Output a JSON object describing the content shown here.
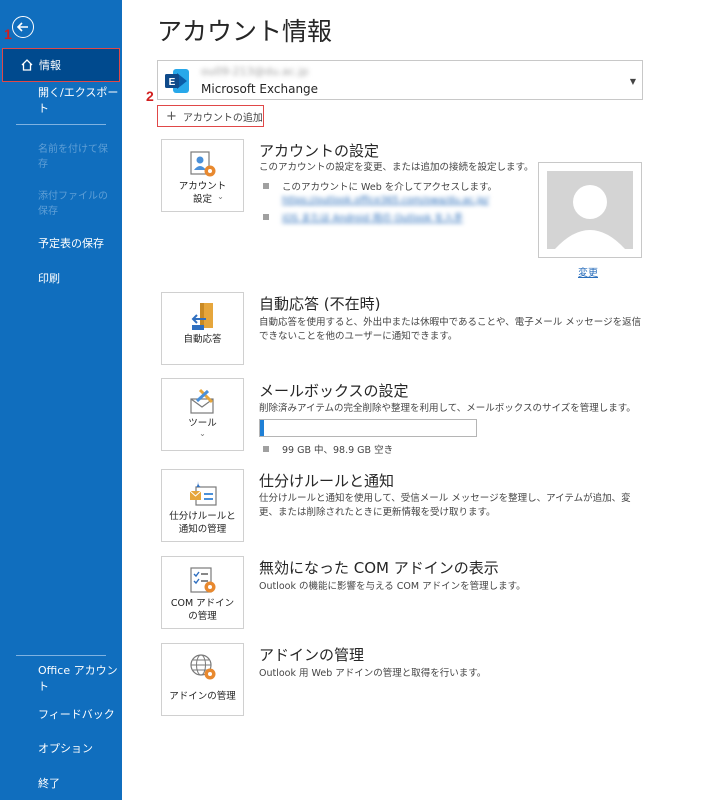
{
  "steps": {
    "step1": "1",
    "step2": "2"
  },
  "sidebar": {
    "items": [
      {
        "label": "情報",
        "state": "active"
      },
      {
        "label": "開く/エクスポート",
        "state": "normal"
      },
      {
        "label": "名前を付けて保存",
        "state": "disabled"
      },
      {
        "label": "添付ファイルの保存",
        "state": "disabled"
      },
      {
        "label": "予定表の保存",
        "state": "normal"
      },
      {
        "label": "印刷",
        "state": "normal"
      }
    ],
    "bottom_items": [
      {
        "label": "Office アカウント"
      },
      {
        "label": "フィードバック"
      },
      {
        "label": "オプション"
      },
      {
        "label": "終了"
      }
    ]
  },
  "main": {
    "title": "アカウント情報",
    "account": {
      "email": "ou09-213@du.ac.jp",
      "type": "Microsoft Exchange"
    },
    "add_account_label": "アカウントの追加",
    "sections": [
      {
        "tile_label": "アカウント\n設定",
        "tile_has_dropdown": true,
        "title": "アカウントの設定",
        "description": "このアカウントの設定を変更、または追加の接続を設定します。",
        "bullet1": "このアカウントに Web を介してアクセスします。",
        "link1": "https://outlook.office365.com/owa/du.ac.jp/",
        "link2": "iOS または Android 用の Outlook を入手"
      },
      {
        "tile_label": "自動応答",
        "title": "自動応答 (不在時)",
        "description": "自動応答を使用すると、外出中または休暇中であることや、電子メール メッセージを返信できないことを他のユーザーに通知できます。"
      },
      {
        "tile_label": "ツール",
        "tile_has_dropdown": true,
        "title": "メールボックスの設定",
        "description": "削除済みアイテムの完全削除や整理を利用して、メールボックスのサイズを管理します。",
        "quota_text": "99 GB 中、98.9 GB 空き",
        "quota_used_fraction": 0.02
      },
      {
        "tile_label": "仕分けルールと\n通知の管理",
        "title": "仕分けルールと通知",
        "description": "仕分けルールと通知を使用して、受信メール メッセージを整理し、アイテムが追加、変更、または削除されたときに更新情報を受け取ります。"
      },
      {
        "tile_label": "COM アドイン\nの管理",
        "title": "無効になった COM アドインの表示",
        "description": "Outlook の機能に影響を与える COM アドインを管理します。"
      },
      {
        "tile_label": "アドインの管理",
        "title": "アドインの管理",
        "description": "Outlook 用 Web アドインの管理と取得を行います。"
      }
    ],
    "change_photo_label": "変更"
  },
  "colors": {
    "sidebar_bg": "#106ebe",
    "sidebar_active": "#004a8e",
    "highlight_red": "#e04848",
    "link_blue": "#2a6ebb"
  }
}
